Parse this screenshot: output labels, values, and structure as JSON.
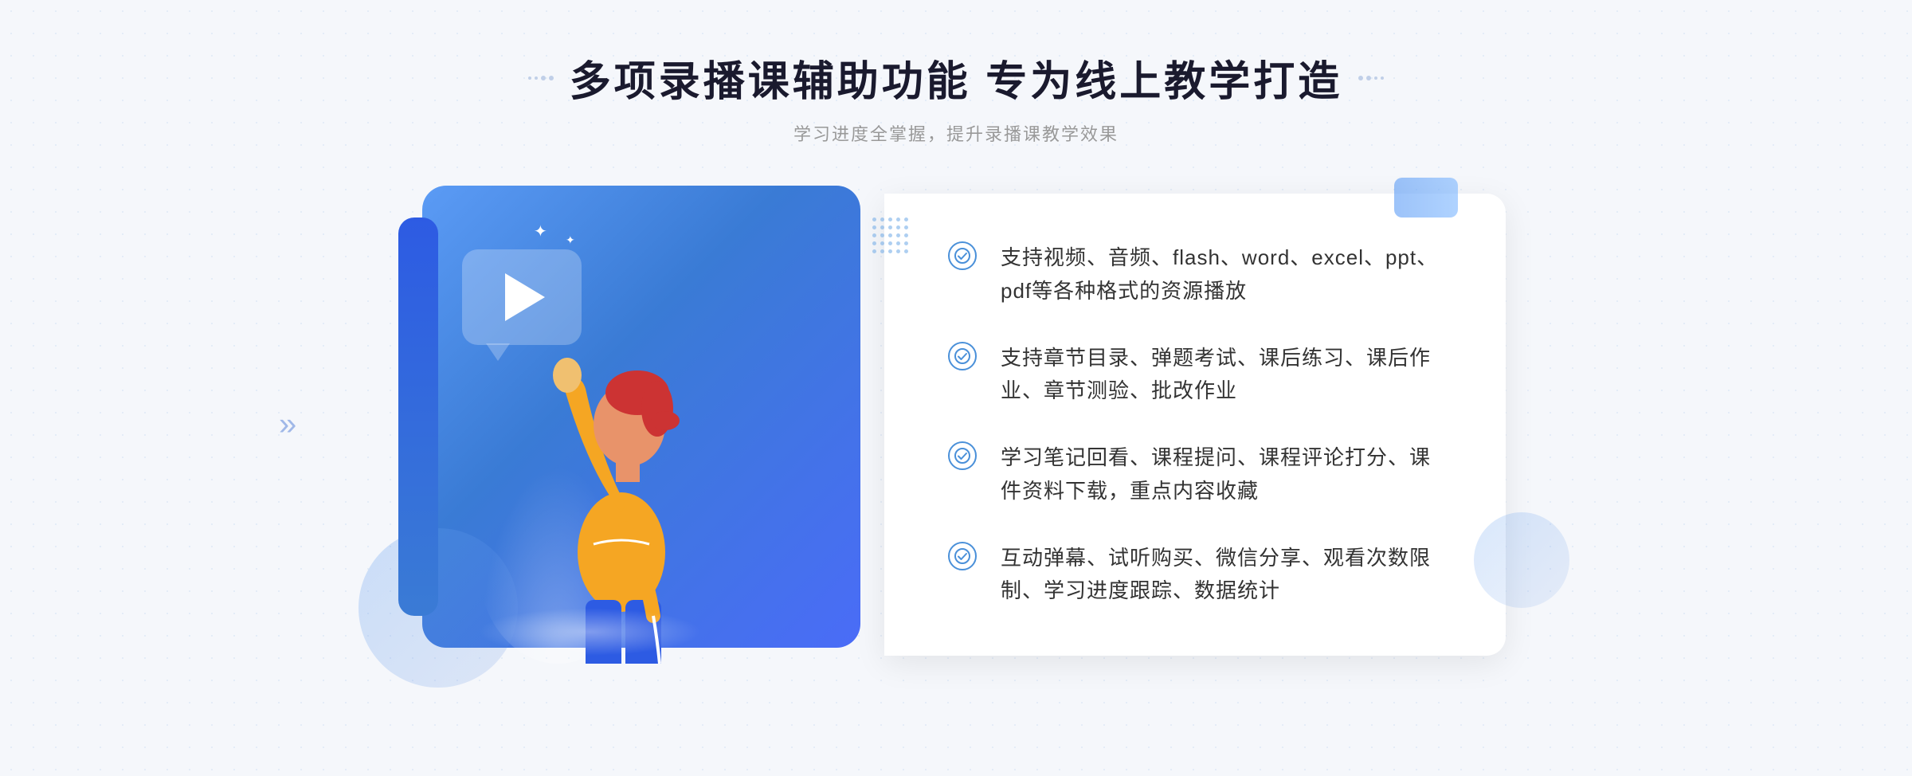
{
  "header": {
    "title": "多项录播课辅助功能 专为线上教学打造",
    "subtitle": "学习进度全掌握，提升录播课教学效果"
  },
  "decorations": {
    "left_arrow": "«",
    "left_arrow_right": "»"
  },
  "features": [
    {
      "id": 1,
      "text": "支持视频、音频、flash、word、excel、ppt、pdf等各种格式的资源播放"
    },
    {
      "id": 2,
      "text": "支持章节目录、弹题考试、课后练习、课后作业、章节测验、批改作业"
    },
    {
      "id": 3,
      "text": "学习笔记回看、课程提问、课程评论打分、课件资料下载，重点内容收藏"
    },
    {
      "id": 4,
      "text": "互动弹幕、试听购买、微信分享、观看次数限制、学习进度跟踪、数据统计"
    }
  ]
}
